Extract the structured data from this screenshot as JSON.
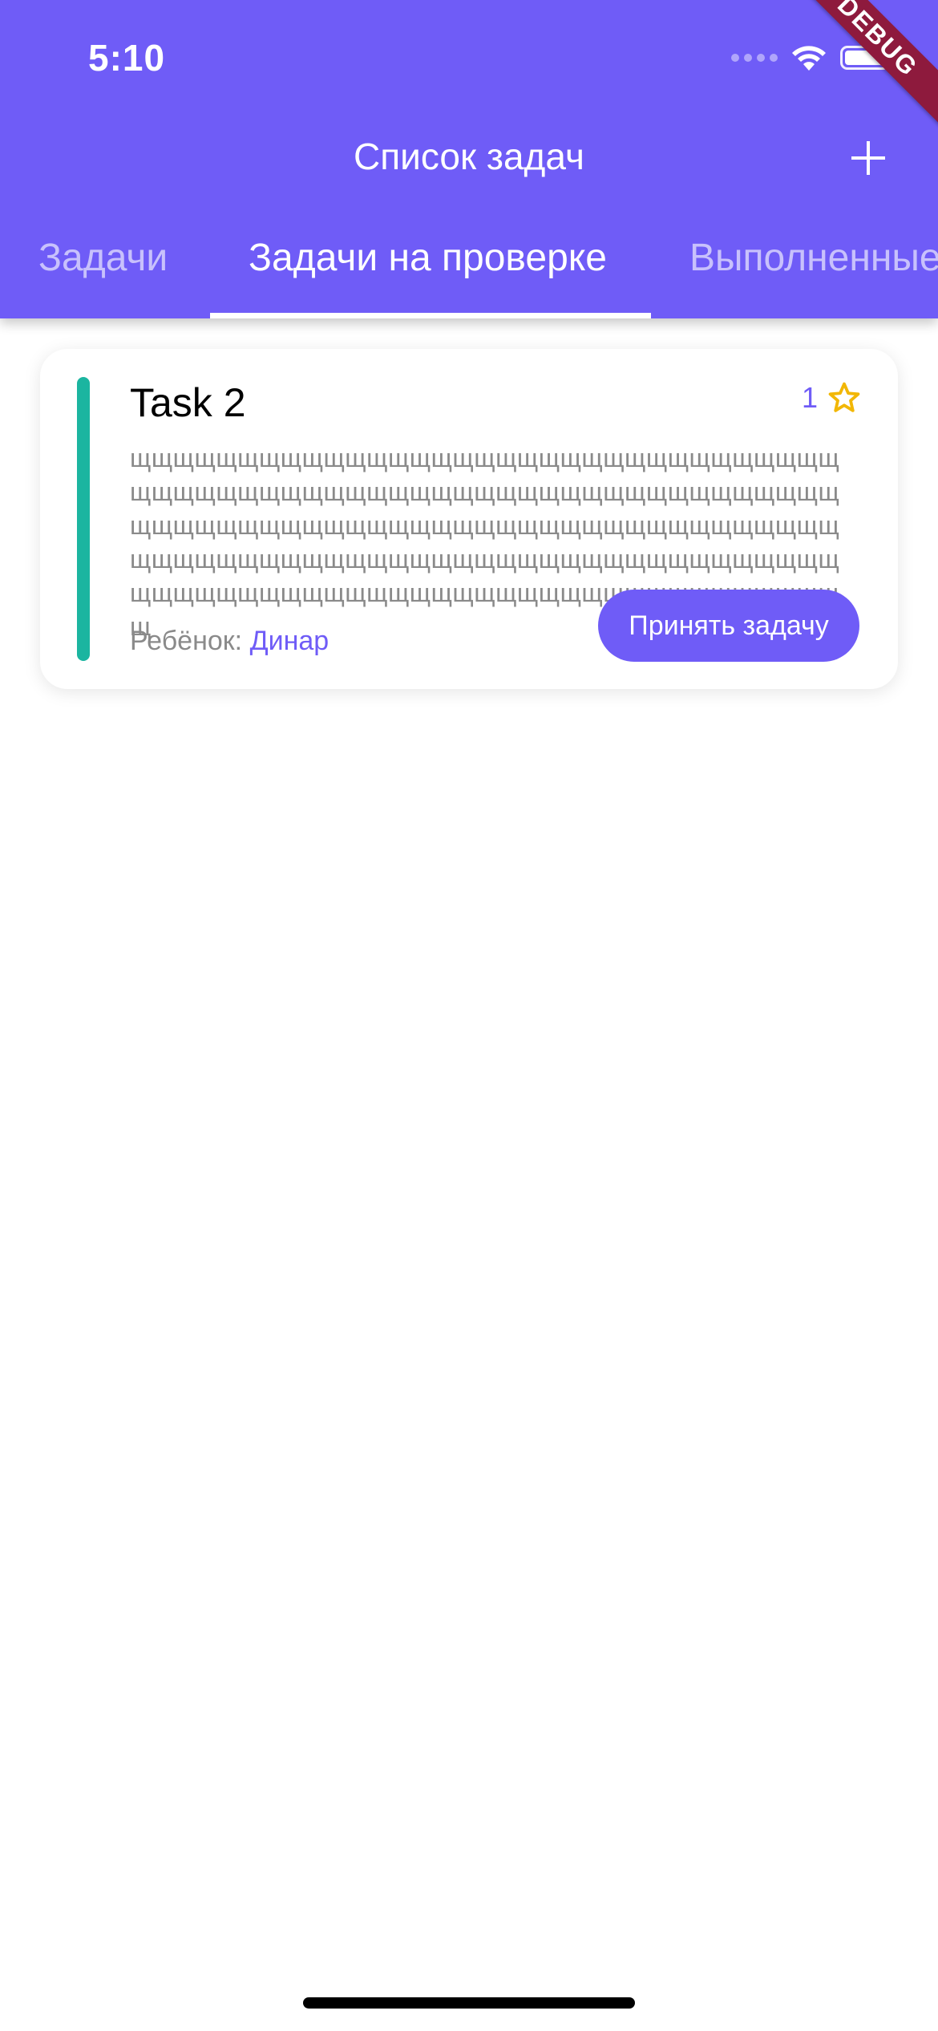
{
  "status_bar": {
    "time": "5:10"
  },
  "app_bar": {
    "title": "Список задач",
    "add_icon": "plus-icon",
    "background_color": "#6F5CF7"
  },
  "tabs": [
    {
      "label": "Задачи",
      "selected": false
    },
    {
      "label": "Задачи на проверке",
      "selected": true
    },
    {
      "label": "Выполненные",
      "selected": false
    }
  ],
  "debug_banner": {
    "label": "DEBUG"
  },
  "task_card": {
    "title": "Task 2",
    "points": "1",
    "points_icon": "star-icon",
    "description": "щщщщщщщщщщщщщщщщщщщщщщщщщщщщщщщщщщщщщщщщщщщщщщщщщщщщщщщщщщщщщщщщщщщщщщщщщщщщщщщщщщщщщщщщщщщщщщщщщщщщщщщщщщщщщщщщщщщщщщщщщщщщщщщщщщщщщщщщщщщщщщщщщщщщщщщщщщщщщщщщщщщщщщ",
    "child_label": "Ребёнок:",
    "child_name": "Динар",
    "accept_button_label": "Принять задачу",
    "accent_color": "#1BB5A0"
  }
}
